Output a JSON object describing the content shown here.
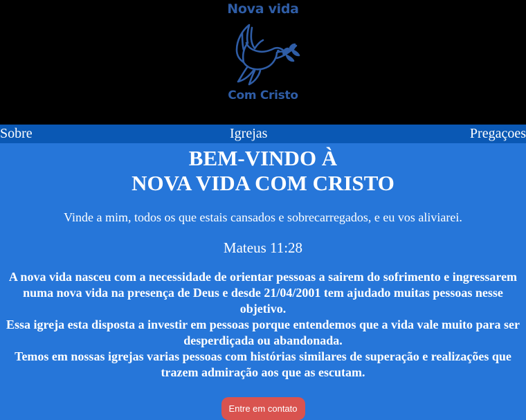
{
  "logo": {
    "top_text": "Nova vida",
    "bottom_text": "Com Cristo",
    "color": "#2f5da6"
  },
  "nav": {
    "items": [
      {
        "label": "Sobre"
      },
      {
        "label": "Igrejas"
      },
      {
        "label": "Pregaçoes"
      }
    ]
  },
  "main": {
    "title_line1": "BEM-VINDO À",
    "title_line2": "NOVA VIDA COM CRISTO",
    "verse": "Vinde a mim, todos os que estais cansados e sobrecarregados, e eu vos aliviarei.",
    "verse_ref": "Mateus 11:28",
    "about_p1": "A nova vida nasceu com a necessidade de orientar pessoas a sairem do sofrimento e ingressarem numa nova vida na presença de Deus e desde 21/04/2001 tem ajudado muitas pessoas nesse objetivo.",
    "about_p2": "Essa igreja esta disposta a investir em pessoas porque entendemos que a vida vale muito para ser desperdiçada ou abandonada.",
    "about_p3": "Temos em nossas igrejas varias pessoas com histórias similares de superação e realizações que trazem admiração aos que as escutam.",
    "contact_button": "Entre em contato"
  },
  "colors": {
    "header_bg": "#000000",
    "nav_bg": "#0a58b4",
    "page_bg": "#2676d9",
    "button_bg": "#d9534f"
  }
}
